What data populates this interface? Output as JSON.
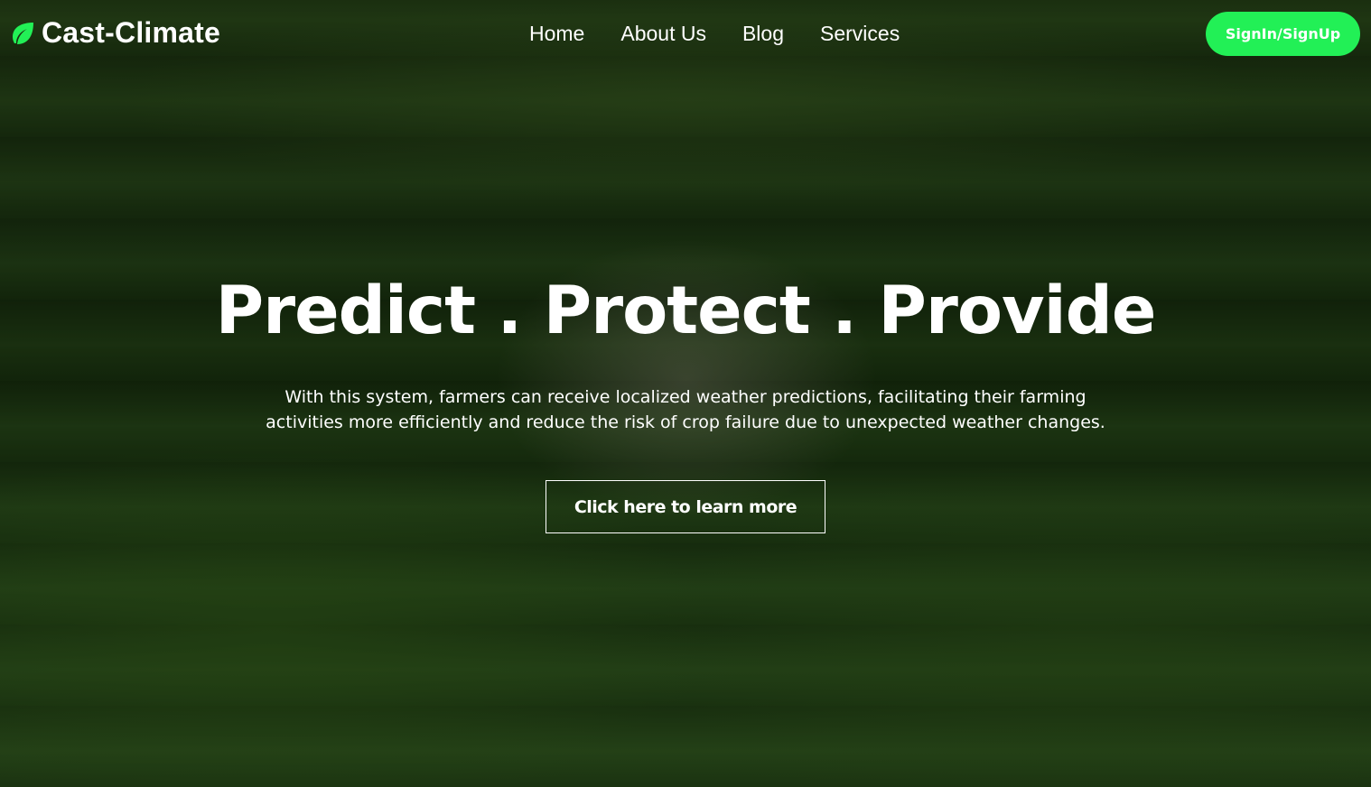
{
  "brand": {
    "name": "Cast-Climate",
    "icon": "leaf-icon",
    "icon_color": "#22f056"
  },
  "nav": {
    "items": [
      {
        "label": "Home"
      },
      {
        "label": "About Us"
      },
      {
        "label": "Blog"
      },
      {
        "label": "Services"
      }
    ],
    "signin_label": "SignIn/SignUp",
    "signin_color": "#22f056"
  },
  "hero": {
    "title": "Predict . Protect . Provide",
    "description": "With this system, farmers can receive localized weather predictions, facilitating their farming activities more efficiently and reduce the risk of crop failure due to unexpected weather changes.",
    "cta_label": "Click here to learn more"
  }
}
